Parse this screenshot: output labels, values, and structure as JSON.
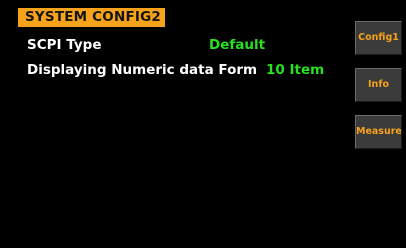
{
  "header": {
    "title": "SYSTEM CONFIG2"
  },
  "settings": [
    {
      "label": "SCPI Type",
      "value": "Default"
    },
    {
      "label": "Displaying Numeric data Form",
      "value": "10 Item"
    }
  ],
  "side_menu": {
    "items": [
      {
        "label": "Config1"
      },
      {
        "label": "Info"
      },
      {
        "label": "Measure"
      }
    ]
  },
  "colors": {
    "background": "#000000",
    "accent": "#f7a21b",
    "value_text": "#27e01f",
    "label_text": "#ffffff",
    "button_bg": "#3b3b3b"
  }
}
